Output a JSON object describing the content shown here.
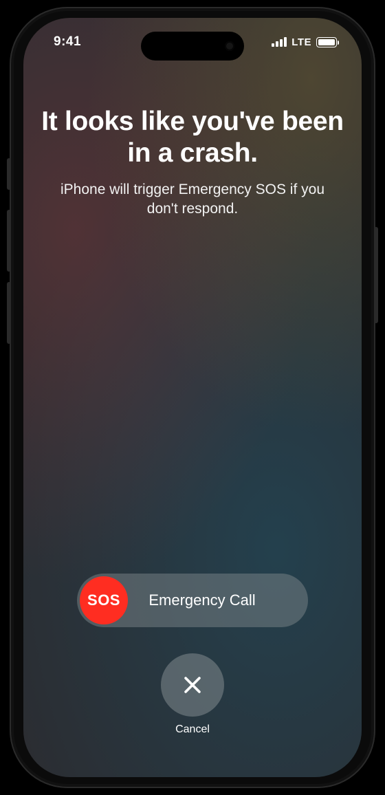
{
  "status": {
    "time": "9:41",
    "network_label": "LTE"
  },
  "alert": {
    "headline": "It looks like you've been in a crash.",
    "subhead": "iPhone will trigger Emergency SOS if you don't respond."
  },
  "slider": {
    "knob_text": "SOS",
    "label": "Emergency Call"
  },
  "cancel": {
    "label": "Cancel"
  },
  "colors": {
    "sos_red": "#ff2d21"
  }
}
